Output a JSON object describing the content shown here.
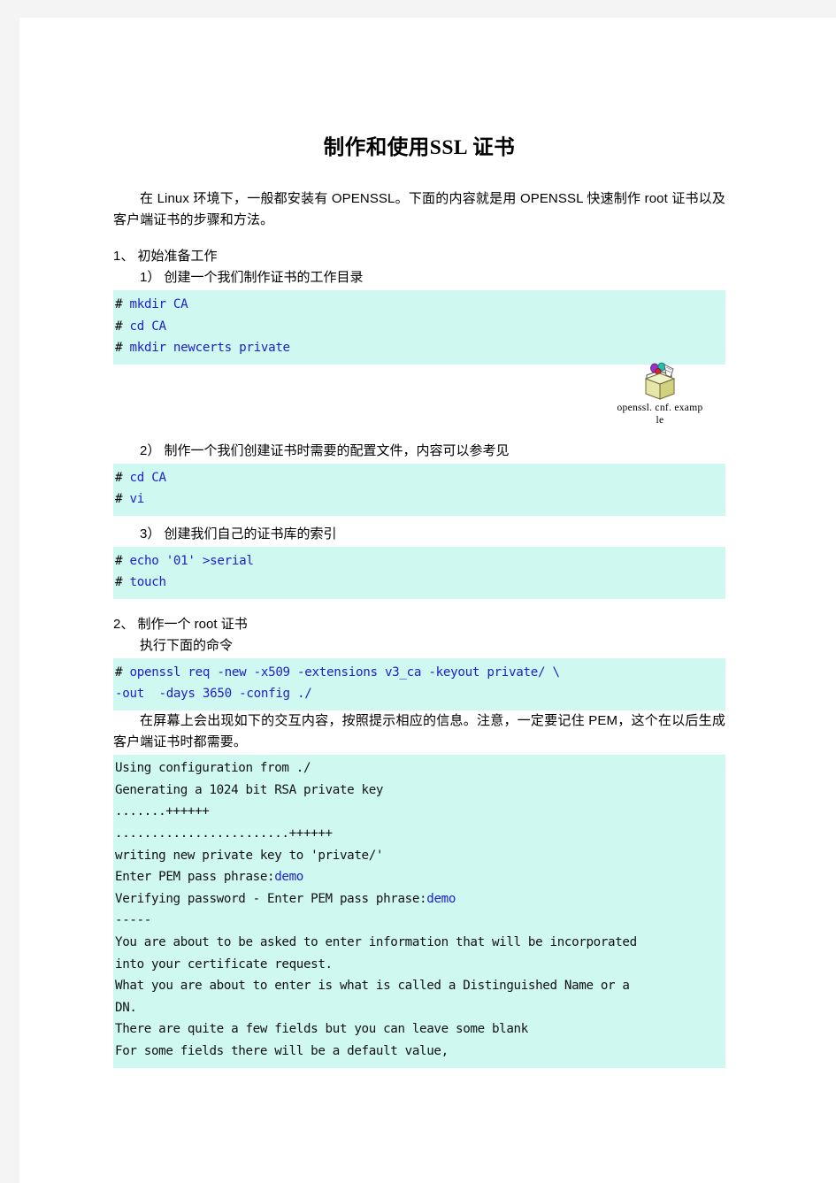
{
  "document": {
    "title_cn_a": "制作和使用",
    "title_latin": "SSL",
    "title_cn_b": "证书",
    "intro": "在 Linux 环境下，一般都安装有 OPENSSL。下面的内容就是用 OPENSSL 快速制作 root 证书以及客户端证书的步骤和方法。",
    "section1": {
      "heading": "1、 初始准备工作",
      "step1": {
        "label": "1） 创建一个我们制作证书的工作目录",
        "code": [
          {
            "prompt": "# ",
            "cmd": "mkdir CA"
          },
          {
            "prompt": "# ",
            "cmd": "cd CA"
          },
          {
            "prompt": "# ",
            "cmd": "mkdir newcerts private"
          }
        ]
      },
      "object": {
        "icon": "package-object-icon",
        "caption_line1": "openssl. cnf. examp",
        "caption_line2": "le"
      },
      "step2": {
        "label": "2） 制作一个我们创建证书时需要的配置文件，内容可以参考见",
        "code": [
          {
            "prompt": "# ",
            "cmd": "cd CA"
          },
          {
            "prompt": "# ",
            "cmd": "vi"
          }
        ]
      },
      "step3": {
        "label": "3） 创建我们自己的证书库的索引",
        "code": [
          {
            "prompt": "# ",
            "cmd": "echo '01' >serial"
          },
          {
            "prompt": "# ",
            "cmd": "touch"
          }
        ]
      }
    },
    "section2": {
      "heading": "2、 制作一个 root 证书",
      "subheading": "执行下面的命令",
      "code": [
        {
          "prompt": "# ",
          "cmd": "openssl req -new -x509 -extensions v3_ca -keyout private/ \\"
        },
        {
          "prompt": "",
          "cmd": "-out  -days 3650 -config ./"
        }
      ],
      "note": "在屏幕上会出现如下的交互内容，按照提示相应的信息。注意，一定要记住 PEM，这个在以后生成客户端证书时都需要。",
      "output": [
        {
          "text": "Using configuration from ./",
          "hl": ""
        },
        {
          "text": "Generating a 1024 bit RSA private key",
          "hl": ""
        },
        {
          "text": ".......++++++",
          "hl": ""
        },
        {
          "text": "........................++++++",
          "hl": ""
        },
        {
          "text": "writing new private key to 'private/'",
          "hl": ""
        },
        {
          "text": "Enter PEM pass phrase:",
          "hl": "demo"
        },
        {
          "text": "Verifying password - Enter PEM pass phrase:",
          "hl": "demo"
        },
        {
          "text": "-----",
          "hl": ""
        },
        {
          "text": "You are about to be asked to enter information that will be incorporated",
          "hl": ""
        },
        {
          "text": "into your certificate request.",
          "hl": ""
        },
        {
          "text": "What you are about to enter is what is called a Distinguished Name or a",
          "hl": ""
        },
        {
          "text": "DN.",
          "hl": ""
        },
        {
          "text": "There are quite a few fields but you can leave some blank",
          "hl": ""
        },
        {
          "text": "For some fields there will be a default value,",
          "hl": ""
        }
      ]
    }
  },
  "colors": {
    "code_bg": "#cff8f1",
    "code_text": "#2020c8",
    "page_bg": "#ffffff",
    "canvas_bg": "#f4f4f4"
  }
}
